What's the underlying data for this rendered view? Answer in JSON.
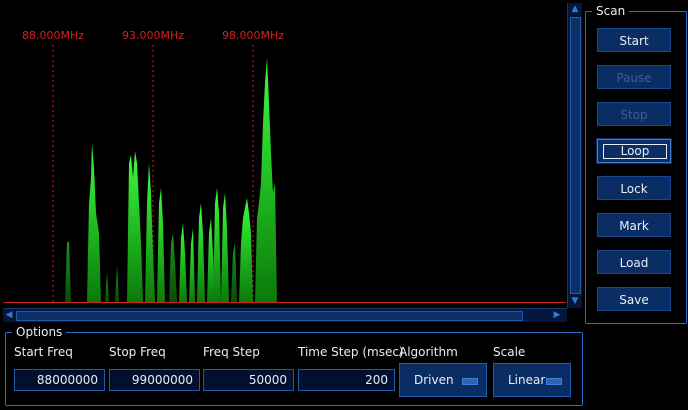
{
  "spectrum": {
    "markers": [
      {
        "label": "88.000MHz"
      },
      {
        "label": "93.000MHz"
      },
      {
        "label": "98.000MHz"
      }
    ],
    "colors": {
      "marker": "#d42020",
      "baseline": "#d42020",
      "peak": "#3cff3c",
      "peak_dark": "#0a5a0a"
    }
  },
  "scan": {
    "title": "Scan",
    "buttons": [
      {
        "id": "start",
        "label": "Start",
        "state": "enabled"
      },
      {
        "id": "pause",
        "label": "Pause",
        "state": "disabled"
      },
      {
        "id": "stop",
        "label": "Stop",
        "state": "disabled"
      },
      {
        "id": "loop",
        "label": "Loop",
        "state": "focused"
      },
      {
        "id": "lock",
        "label": "Lock",
        "state": "enabled"
      },
      {
        "id": "mark",
        "label": "Mark",
        "state": "enabled"
      },
      {
        "id": "load",
        "label": "Load",
        "state": "enabled"
      },
      {
        "id": "save",
        "label": "Save",
        "state": "enabled"
      }
    ]
  },
  "options": {
    "title": "Options",
    "start_freq": {
      "label": "Start Freq",
      "value": "88000000"
    },
    "stop_freq": {
      "label": "Stop Freq",
      "value": "99000000"
    },
    "freq_step": {
      "label": "Freq Step",
      "value": "50000"
    },
    "time_step": {
      "label": "Time Step (msec)",
      "value": "200"
    },
    "algorithm": {
      "label": "Algorithm",
      "value": "Driven"
    },
    "scale": {
      "label": "Scale",
      "value": "Linear"
    }
  },
  "scrollbars": {
    "up_arrow": "▲",
    "down_arrow": "▼",
    "left_arrow": "◀",
    "right_arrow": "▶"
  }
}
